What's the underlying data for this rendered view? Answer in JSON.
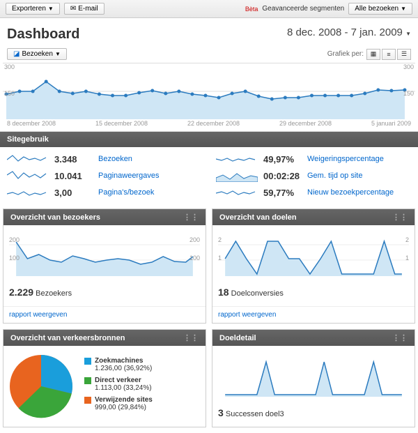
{
  "toolbar": {
    "export": "Exporteren",
    "email": "E-mail",
    "beta": "Bèta",
    "segments": "Geavanceerde segmenten",
    "all_visits": "Alle bezoeken"
  },
  "header": {
    "title": "Dashboard",
    "date_range": "8 dec. 2008 - 7 jan. 2009"
  },
  "controls": {
    "visits_btn": "Bezoeken",
    "grafiek_per": "Grafiek per:"
  },
  "main_chart": {
    "y_left": "300",
    "y_left2": "150",
    "y_right": "300",
    "y_right2": "150",
    "x_labels": [
      "8 december 2008",
      "15 december 2008",
      "22 december 2008",
      "29 december 2008",
      "5 januari 2009"
    ]
  },
  "sections": {
    "sitegebruik": "Sitegebruik",
    "bezoekers": "Overzicht van bezoekers",
    "doelen": "Overzicht van doelen",
    "verkeer": "Overzicht van verkeersbronnen",
    "doeldetail": "Doeldetail"
  },
  "usage": {
    "left": [
      {
        "value": "3.348",
        "label": "Bezoeken"
      },
      {
        "value": "10.041",
        "label": "Paginaweergaves"
      },
      {
        "value": "3,00",
        "label": "Pagina's/bezoek"
      }
    ],
    "right": [
      {
        "value": "49,97%",
        "label": "Weigeringspercentage"
      },
      {
        "value": "00:02:28",
        "label": "Gem. tijd op site"
      },
      {
        "value": "59,77%",
        "label": "Nieuw bezoekpercentage"
      }
    ]
  },
  "bezoekers_panel": {
    "y1": "200",
    "y2": "100",
    "stat_val": "2.229",
    "stat_label": "Bezoekers",
    "link": "rapport weergeven"
  },
  "doelen_panel": {
    "y1": "2",
    "y2": "1",
    "stat_val": "18",
    "stat_label": "Doelconversies",
    "link": "rapport weergeven"
  },
  "verkeer_panel": {
    "items": [
      {
        "color": "#1a9edb",
        "name": "Zoekmachines",
        "detail": "1.236,00 (36,92%)"
      },
      {
        "color": "#3aa53a",
        "name": "Direct verkeer",
        "detail": "1.113,00 (33,24%)"
      },
      {
        "color": "#e8641f",
        "name": "Verwijzende sites",
        "detail": "999,00 (29,84%)"
      }
    ]
  },
  "doeldetail_panel": {
    "stat_val": "3",
    "stat_label": "Successen doel3"
  },
  "chart_data": {
    "main": {
      "type": "line",
      "title": "Bezoeken",
      "ylim": [
        0,
        300
      ],
      "x_range": "8 december 2008 – 5 januari 2009",
      "values": [
        140,
        150,
        150,
        205,
        150,
        140,
        150,
        135,
        130,
        130,
        145,
        155,
        140,
        150,
        135,
        130,
        120,
        140,
        150,
        125,
        110,
        120,
        120,
        130,
        130,
        130,
        130,
        140,
        160,
        155,
        160
      ]
    },
    "bezoekers": {
      "type": "line",
      "ylim": [
        0,
        250
      ],
      "values": [
        200,
        120,
        140,
        110,
        100,
        130,
        120,
        100,
        110,
        120,
        110,
        90,
        100,
        125,
        105,
        100,
        125
      ]
    },
    "doelen": {
      "type": "line",
      "ylim": [
        0,
        2.5
      ],
      "values": [
        1,
        2,
        1,
        0,
        2,
        2,
        1,
        1,
        0,
        1,
        2,
        0,
        0,
        0,
        0,
        2,
        0,
        0
      ]
    },
    "doeldetail": {
      "type": "line",
      "values": [
        0,
        0,
        0,
        0,
        1,
        0,
        0,
        0,
        0,
        0,
        1,
        0,
        0,
        0,
        0,
        1,
        0,
        0
      ]
    },
    "traffic_pie": {
      "type": "pie",
      "slices": [
        {
          "name": "Zoekmachines",
          "value": 1236,
          "pct": 36.92
        },
        {
          "name": "Direct verkeer",
          "value": 1113,
          "pct": 33.24
        },
        {
          "name": "Verwijzende sites",
          "value": 999,
          "pct": 29.84
        }
      ]
    }
  }
}
